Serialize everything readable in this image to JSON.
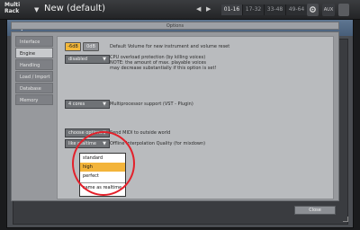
{
  "host": {
    "title": "Multi Rack",
    "preset": "New (default)",
    "tabs": [
      "01-16",
      "17-32",
      "33-48",
      "49-64"
    ],
    "active_tab": "01-16",
    "aux_label": "AUX"
  },
  "dialog": {
    "title": "Options",
    "header": "Options",
    "categories": [
      {
        "label": "Interface"
      },
      {
        "label": "Engine",
        "active": true
      },
      {
        "label": "Handling"
      },
      {
        "label": "Load / Import"
      },
      {
        "label": "Database"
      },
      {
        "label": "Memory"
      }
    ],
    "engine": {
      "volume_on": "-6dB",
      "volume_off": "0dB",
      "volume_desc": "Default Volume for new instrument and volume reset",
      "cpu_dropdown": "disabled",
      "cpu_desc": [
        "CPU overload protection (by killing voices)",
        "NOTE: the amount of max. playable voices",
        "may decrease substantially if this option is set!"
      ],
      "multicore_dropdown": "4 cores",
      "multicore_desc": "Multiprocessor support   (VST - Plugin)",
      "midi_dropdown": "choose options",
      "midi_desc": "Send MIDI to outside world",
      "interp_dropdown": "like realtime",
      "interp_desc": "Offline Interpolation Quality (for mixdown)",
      "interp_options": [
        "standard",
        "high",
        "perfect",
        "same as realtime"
      ],
      "interp_highlight": "high"
    },
    "close_label": "Close"
  },
  "colors": {
    "titlebar": "#526a85",
    "accent": "#f4b83a",
    "annotation": "#e3202a"
  }
}
